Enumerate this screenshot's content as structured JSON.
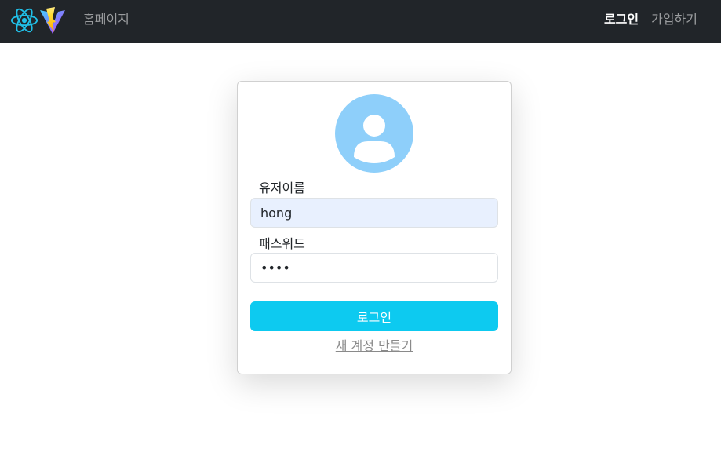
{
  "navbar": {
    "brand": "홈페이지",
    "links": [
      {
        "label": "로그인",
        "active": true
      },
      {
        "label": "가입하기",
        "active": false
      }
    ],
    "logos": [
      "react-logo-icon",
      "vite-logo-icon"
    ],
    "background": "#212529"
  },
  "login_form": {
    "avatar_icon": "user-avatar-icon",
    "username_label": "유저이름",
    "username_value": "hong",
    "password_label": "패스워드",
    "password_value": "1234",
    "submit_label": "로그인",
    "create_account_link": "새 계정 만들기"
  },
  "colors": {
    "accent": "#0dcaf0",
    "avatar": "#8ecffa",
    "autofill_bg": "#e8f0fe"
  }
}
